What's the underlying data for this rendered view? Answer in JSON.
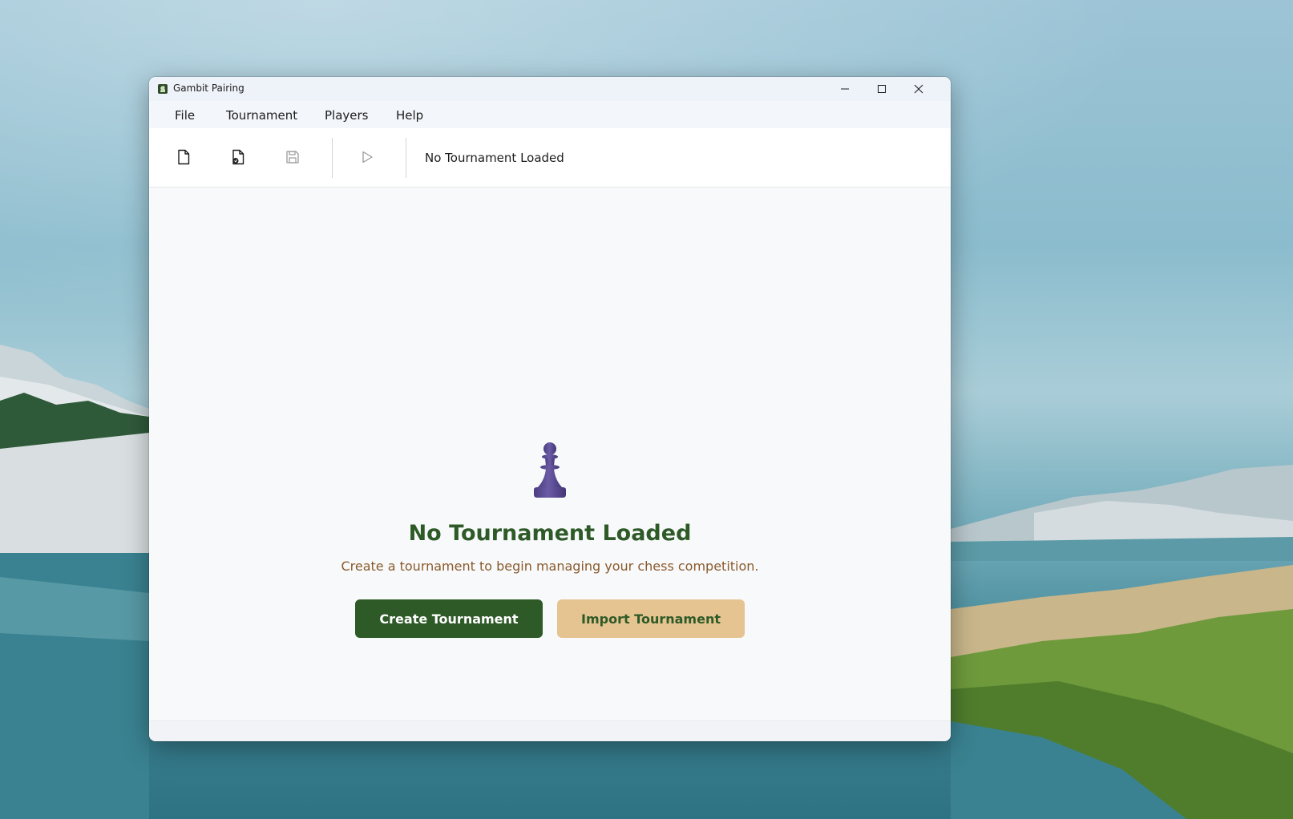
{
  "window": {
    "title": "Gambit Pairing"
  },
  "menu": {
    "items": [
      "File",
      "Tournament",
      "Players",
      "Help"
    ]
  },
  "toolbar": {
    "status": "No Tournament Loaded",
    "icons": [
      "new-file-icon",
      "open-file-icon",
      "save-icon",
      "play-icon"
    ]
  },
  "empty_state": {
    "icon": "chess-pawn-icon",
    "title": "No Tournament Loaded",
    "subtitle": "Create a tournament to begin managing your chess competition.",
    "primary_label": "Create Tournament",
    "secondary_label": "Import Tournament"
  },
  "colors": {
    "accent_green": "#2e5a27",
    "accent_tan": "#e6c491",
    "subtitle_brown": "#8a5a2b",
    "pawn_purple": "#5a4a8f"
  }
}
